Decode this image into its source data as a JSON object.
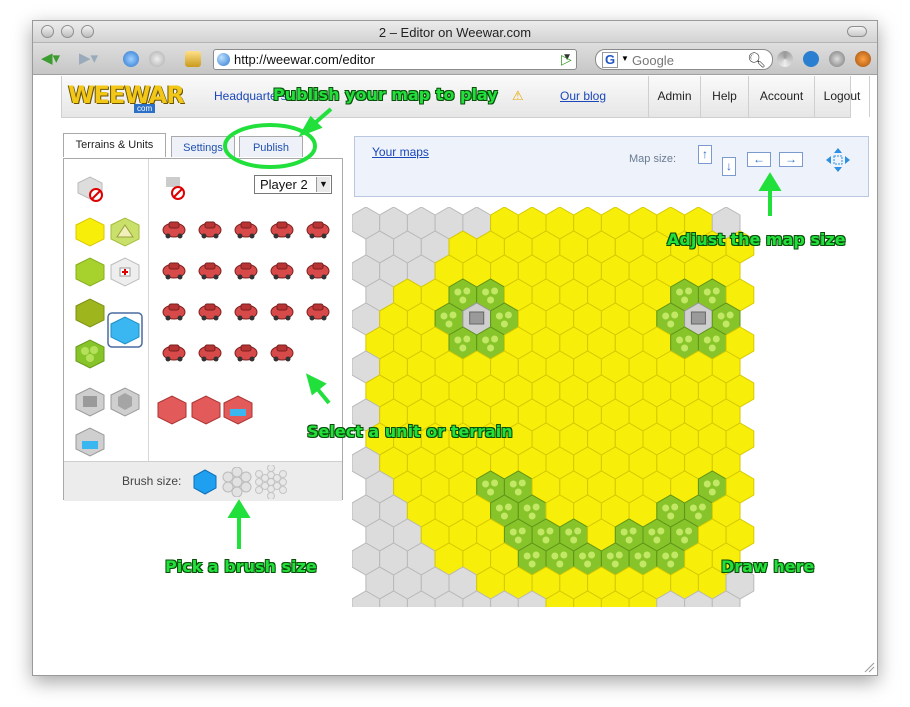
{
  "window": {
    "title": "2 – Editor on Weewar.com"
  },
  "browser": {
    "url": "http://weewar.com/editor",
    "search_engine": "G",
    "search_placeholder": "Google"
  },
  "site": {
    "logo_text": "WEEWAR",
    "logo_sub": "com",
    "nav_headquarters": "Headquarters",
    "nav_blog": "Our blog",
    "nav_items": [
      "Admin",
      "Help",
      "Account",
      "Logout"
    ]
  },
  "editor": {
    "tabs": [
      "Terrains & Units",
      "Settings",
      "Publish"
    ],
    "player_select": "Player 2",
    "brush_label": "Brush size:",
    "your_maps": "Your maps",
    "map_size_label": "Map size:"
  },
  "annotations": {
    "publish": "Publish your map to play",
    "map_size": "Adjust the map size",
    "select": "Select a unit or terrain",
    "brush": "Pick a brush size",
    "draw": "Draw here"
  },
  "colors": {
    "plains": "#f7ee0a",
    "forest": "#86c42a",
    "empty": "#dcdcdc",
    "unit": "#d84a4a",
    "annotation": "#22e03c"
  }
}
